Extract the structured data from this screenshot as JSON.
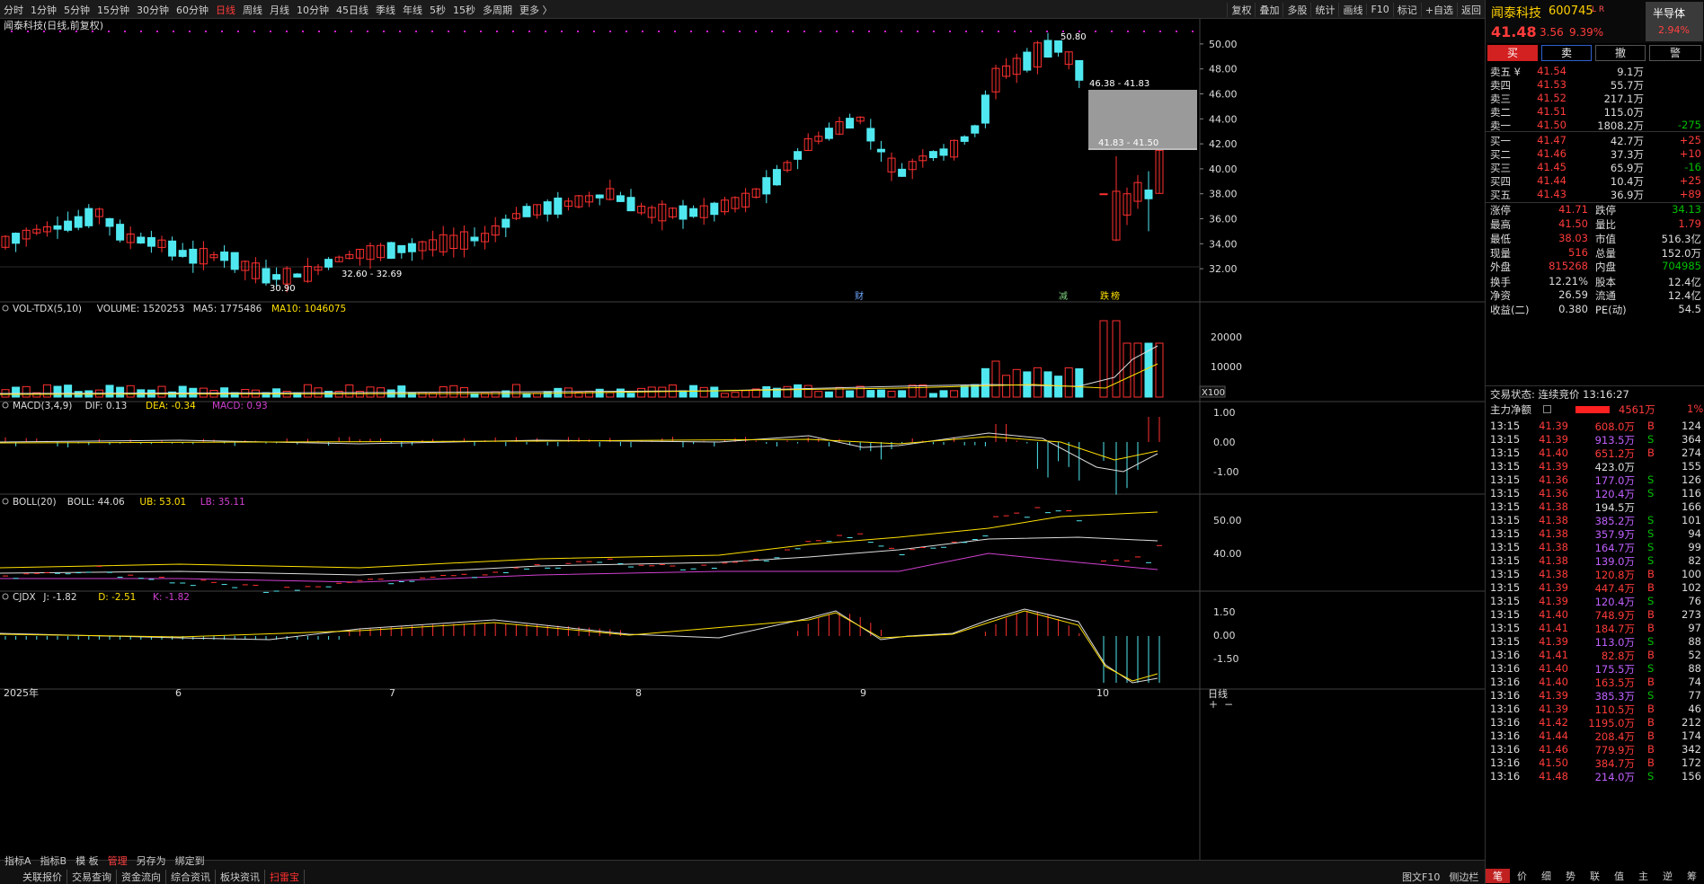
{
  "stock": {
    "name": "闻泰科技",
    "code": "600745",
    "tag": "L R",
    "price": "41.48",
    "change": "3.56",
    "pct": "9.39%",
    "sector": "半导体",
    "sector_pct": "2.94%"
  },
  "toolbar": {
    "left": [
      "分时",
      "1分钟",
      "5分钟",
      "15分钟",
      "30分钟",
      "60分钟",
      "日线",
      "周线",
      "月线",
      "10分钟",
      "45日线",
      "季线",
      "年线",
      "5秒",
      "15秒",
      "多周期",
      "更多 〉"
    ],
    "active": "日线",
    "right": [
      "复权",
      "叠加",
      "多股",
      "统计",
      "画线",
      "F10",
      "标记",
      "+自选",
      "返回"
    ]
  },
  "chart_title": "闻泰科技(日线,前复权)",
  "buttons": {
    "buy": "买",
    "sell": "卖",
    "cancel": "撤",
    "alert": "警"
  },
  "asks": [
    {
      "label": "卖五 ¥",
      "price": "41.54",
      "vol": "9.1万",
      "chg": ""
    },
    {
      "label": "卖四",
      "price": "41.53",
      "vol": "55.7万",
      "chg": ""
    },
    {
      "label": "卖三",
      "price": "41.52",
      "vol": "217.1万",
      "chg": ""
    },
    {
      "label": "卖二",
      "price": "41.51",
      "vol": "115.0万",
      "chg": ""
    },
    {
      "label": "卖一",
      "price": "41.50",
      "vol": "1808.2万",
      "chg": "-275"
    }
  ],
  "bids": [
    {
      "label": "买一",
      "price": "41.47",
      "vol": "42.7万",
      "chg": "+25"
    },
    {
      "label": "买二",
      "price": "41.46",
      "vol": "37.3万",
      "chg": "+10"
    },
    {
      "label": "买三",
      "price": "41.45",
      "vol": "65.9万",
      "chg": "-16"
    },
    {
      "label": "买四",
      "price": "41.44",
      "vol": "10.4万",
      "chg": "+25"
    },
    {
      "label": "买五",
      "price": "41.43",
      "vol": "36.9万",
      "chg": "+89"
    }
  ],
  "stats": [
    [
      "涨停",
      "41.71",
      "跌停",
      "34.13"
    ],
    [
      "最高",
      "41.50",
      "量比",
      "1.79"
    ],
    [
      "最低",
      "38.03",
      "市值",
      "516.3亿"
    ],
    [
      "现量",
      "516",
      "总量",
      "152.0万"
    ],
    [
      "外盘",
      "815268",
      "内盘",
      "704985"
    ],
    [
      "换手",
      "12.21%",
      "股本",
      "12.4亿"
    ],
    [
      "净资",
      "26.59",
      "流通",
      "12.4亿"
    ],
    [
      "收益(二)",
      "0.380",
      "PE(动)",
      "54.5"
    ]
  ],
  "trade_status": "交易状态: 连续竞价 13:16:27",
  "main_net": {
    "label": "主力净额",
    "value": "4561万",
    "pct": "1%"
  },
  "ticks": [
    [
      "13:15",
      "41.39",
      "608.0万",
      "B",
      "124"
    ],
    [
      "13:15",
      "41.39",
      "913.5万",
      "S",
      "364"
    ],
    [
      "13:15",
      "41.40",
      "651.2万",
      "B",
      "274"
    ],
    [
      "13:15",
      "41.39",
      "423.0万",
      "",
      "155"
    ],
    [
      "13:15",
      "41.36",
      "177.0万",
      "S",
      "126"
    ],
    [
      "13:15",
      "41.36",
      "120.4万",
      "S",
      "116"
    ],
    [
      "13:15",
      "41.38",
      "194.5万",
      "",
      "166"
    ],
    [
      "13:15",
      "41.38",
      "385.2万",
      "S",
      "101"
    ],
    [
      "13:15",
      "41.38",
      "357.9万",
      "S",
      "94"
    ],
    [
      "13:15",
      "41.38",
      "164.7万",
      "S",
      "99"
    ],
    [
      "13:15",
      "41.38",
      "139.0万",
      "S",
      "82"
    ],
    [
      "13:15",
      "41.38",
      "120.8万",
      "B",
      "100"
    ],
    [
      "13:15",
      "41.39",
      "447.4万",
      "B",
      "102"
    ],
    [
      "13:15",
      "41.39",
      "120.4万",
      "S",
      "76"
    ],
    [
      "13:15",
      "41.40",
      "748.9万",
      "B",
      "273"
    ],
    [
      "13:15",
      "41.41",
      "184.7万",
      "B",
      "97"
    ],
    [
      "13:15",
      "41.39",
      "113.0万",
      "S",
      "88"
    ],
    [
      "13:16",
      "41.41",
      "82.8万",
      "B",
      "52"
    ],
    [
      "13:16",
      "41.40",
      "175.5万",
      "S",
      "88"
    ],
    [
      "13:16",
      "41.40",
      "163.5万",
      "B",
      "74"
    ],
    [
      "13:16",
      "41.39",
      "385.3万",
      "S",
      "77"
    ],
    [
      "13:16",
      "41.39",
      "110.5万",
      "B",
      "46"
    ],
    [
      "13:16",
      "41.42",
      "1195.0万",
      "B",
      "212"
    ],
    [
      "13:16",
      "41.44",
      "208.4万",
      "B",
      "174"
    ],
    [
      "13:16",
      "41.46",
      "779.9万",
      "B",
      "342"
    ],
    [
      "13:16",
      "41.50",
      "384.7万",
      "B",
      "172"
    ],
    [
      "13:16",
      "41.48",
      "214.0万",
      "S",
      "156"
    ]
  ],
  "panes": {
    "vol": {
      "name": "VOL-TDX(5,10)",
      "volume": "VOLUME: 1520253",
      "ma5": "MA5: 1775486",
      "ma10": "MA10: 1046075",
      "axis": [
        "20000",
        "10000"
      ],
      "unit": "X100"
    },
    "macd": {
      "name": "MACD(3,4,9)",
      "dif": "DIF: 0.13",
      "dea": "DEA: -0.34",
      "macd": "MACD: 0.93",
      "axis": [
        "1.00",
        "0.00",
        "-1.00"
      ]
    },
    "boll": {
      "name": "BOLL(20)",
      "boll": "BOLL: 44.06",
      "ub": "UB: 53.01",
      "lb": "LB: 35.11",
      "axis": [
        "50.00",
        "40.00"
      ]
    },
    "cjdx": {
      "name": "CJDX",
      "j": "J: -1.82",
      "d": "D: -2.51",
      "k": "K: -1.82",
      "axis": [
        "1.50",
        "0.00",
        "-1.50"
      ]
    }
  },
  "annotations": {
    "high": "50.80",
    "low": "30.90",
    "range1": "32.60 - 32.69",
    "range2": "46.38 - 41.83",
    "range3": "41.83 - 41.50",
    "mark_cai": "财",
    "mark_jian": "减",
    "mark_dieb": "跌",
    "mark_bang": "榜"
  },
  "chart_data": {
    "type": "candlestick",
    "y_axis": [
      "50.00",
      "48.00",
      "46.00",
      "44.00",
      "42.00",
      "40.00",
      "38.00",
      "36.00",
      "34.00",
      "32.00"
    ],
    "x_axis": [
      "2025年",
      "6",
      "7",
      "8",
      "9",
      "10"
    ],
    "period_label": "日线",
    "high": 50.8,
    "low": 30.9,
    "last": {
      "open": 38.03,
      "high": 41.5,
      "low": 38.03,
      "close": 41.48
    }
  },
  "bottom": {
    "index_tabs": [
      "指标A",
      "指标B",
      "模 板",
      "管理",
      "另存为",
      "绑定到"
    ],
    "active_tab": "管理",
    "func_tabs": [
      "关联报价",
      "交易查询",
      "资金流向",
      "综合资讯",
      "板块资讯",
      "扫雷宝"
    ],
    "active_func": "扫雷宝",
    "right_tabs": [
      "图文F10",
      "侧边栏"
    ],
    "small_tabs": [
      "笔",
      "价",
      "细",
      "势",
      "联",
      "值",
      "主",
      "逆",
      "筹"
    ]
  }
}
